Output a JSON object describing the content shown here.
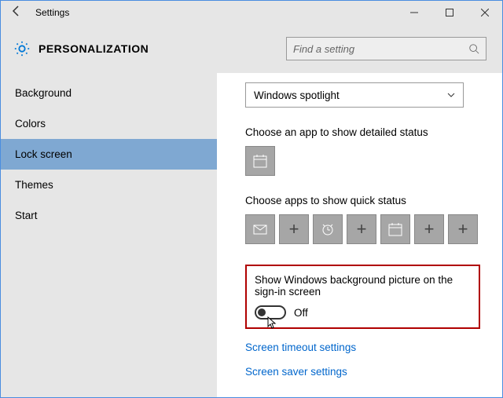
{
  "titlebar": {
    "title": "Settings"
  },
  "header": {
    "title": "PERSONALIZATION"
  },
  "search": {
    "placeholder": "Find a setting"
  },
  "sidebar": {
    "items": [
      {
        "label": "Background",
        "selected": false
      },
      {
        "label": "Colors",
        "selected": false
      },
      {
        "label": "Lock screen",
        "selected": true
      },
      {
        "label": "Themes",
        "selected": false
      },
      {
        "label": "Start",
        "selected": false
      }
    ]
  },
  "content": {
    "dropdown_value": "Windows spotlight",
    "detailed_label": "Choose an app to show detailed status",
    "quick_label": "Choose apps to show quick status",
    "signin_toggle_label": "Show Windows background picture on the sign-in screen",
    "signin_toggle_value": "Off",
    "link_timeout": "Screen timeout settings",
    "link_saver": "Screen saver settings"
  }
}
